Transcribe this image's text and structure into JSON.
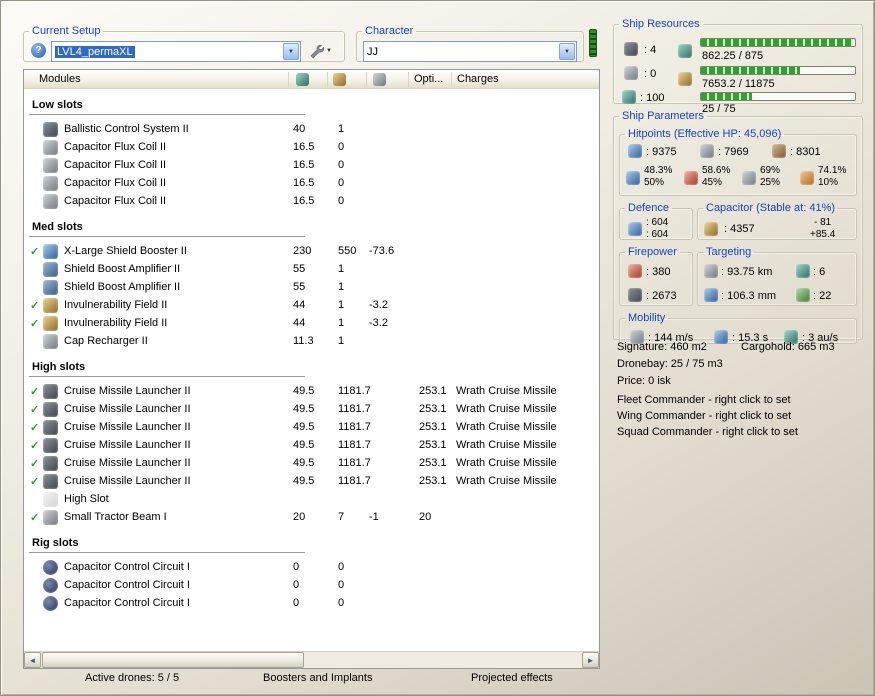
{
  "toolbar": {
    "current_setup_label": "Current Setup",
    "setup_value": "LVL4_permaXL",
    "character_label": "Character",
    "character_value": "JJ"
  },
  "modules_panel": {
    "title": "Modules",
    "col_opti": "Opti...",
    "col_charges": "Charges",
    "sections": [
      {
        "title": "Low slots",
        "rows": [
          {
            "active": false,
            "icon": "ballistic-control-icon",
            "name": "Ballistic Control System II",
            "cpu": "40",
            "pg": "1",
            "cap": "",
            "opti": "",
            "charge": ""
          },
          {
            "active": false,
            "icon": "capacitor-flux-coil-icon",
            "name": "Capacitor Flux Coil II",
            "cpu": "16.5",
            "pg": "0",
            "cap": "",
            "opti": "",
            "charge": ""
          },
          {
            "active": false,
            "icon": "capacitor-flux-coil-icon",
            "name": "Capacitor Flux Coil II",
            "cpu": "16.5",
            "pg": "0",
            "cap": "",
            "opti": "",
            "charge": ""
          },
          {
            "active": false,
            "icon": "capacitor-flux-coil-icon",
            "name": "Capacitor Flux Coil II",
            "cpu": "16.5",
            "pg": "0",
            "cap": "",
            "opti": "",
            "charge": ""
          },
          {
            "active": false,
            "icon": "capacitor-flux-coil-icon",
            "name": "Capacitor Flux Coil II",
            "cpu": "16.5",
            "pg": "0",
            "cap": "",
            "opti": "",
            "charge": ""
          }
        ]
      },
      {
        "title": "Med slots",
        "rows": [
          {
            "active": true,
            "icon": "shield-booster-icon",
            "name": "X-Large Shield Booster II",
            "cpu": "230",
            "pg": "550",
            "cap": "-73.6",
            "opti": "",
            "charge": ""
          },
          {
            "active": false,
            "icon": "shield-boost-amplifier-icon",
            "name": "Shield Boost Amplifier II",
            "cpu": "55",
            "pg": "1",
            "cap": "",
            "opti": "",
            "charge": ""
          },
          {
            "active": false,
            "icon": "shield-boost-amplifier-icon",
            "name": "Shield Boost Amplifier II",
            "cpu": "55",
            "pg": "1",
            "cap": "",
            "opti": "",
            "charge": ""
          },
          {
            "active": true,
            "icon": "invulnerability-field-icon",
            "name": "Invulnerability Field II",
            "cpu": "44",
            "pg": "1",
            "cap": "-3.2",
            "opti": "",
            "charge": ""
          },
          {
            "active": true,
            "icon": "invulnerability-field-icon",
            "name": "Invulnerability Field II",
            "cpu": "44",
            "pg": "1",
            "cap": "-3.2",
            "opti": "",
            "charge": ""
          },
          {
            "active": false,
            "icon": "cap-recharger-icon",
            "name": "Cap Recharger II",
            "cpu": "11.3",
            "pg": "1",
            "cap": "",
            "opti": "",
            "charge": ""
          }
        ]
      },
      {
        "title": "High slots",
        "rows": [
          {
            "active": true,
            "icon": "cruise-launcher-icon",
            "name": "Cruise Missile Launcher II",
            "cpu": "49.5",
            "pg": "1181.7",
            "cap": "",
            "opti": "253.1",
            "charge": "Wrath Cruise Missile"
          },
          {
            "active": true,
            "icon": "cruise-launcher-icon",
            "name": "Cruise Missile Launcher II",
            "cpu": "49.5",
            "pg": "1181.7",
            "cap": "",
            "opti": "253.1",
            "charge": "Wrath Cruise Missile"
          },
          {
            "active": true,
            "icon": "cruise-launcher-icon",
            "name": "Cruise Missile Launcher II",
            "cpu": "49.5",
            "pg": "1181.7",
            "cap": "",
            "opti": "253.1",
            "charge": "Wrath Cruise Missile"
          },
          {
            "active": true,
            "icon": "cruise-launcher-icon",
            "name": "Cruise Missile Launcher II",
            "cpu": "49.5",
            "pg": "1181.7",
            "cap": "",
            "opti": "253.1",
            "charge": "Wrath Cruise Missile"
          },
          {
            "active": true,
            "icon": "cruise-launcher-icon",
            "name": "Cruise Missile Launcher II",
            "cpu": "49.5",
            "pg": "1181.7",
            "cap": "",
            "opti": "253.1",
            "charge": "Wrath Cruise Missile"
          },
          {
            "active": true,
            "icon": "cruise-launcher-icon",
            "name": "Cruise Missile Launcher II",
            "cpu": "49.5",
            "pg": "1181.7",
            "cap": "",
            "opti": "253.1",
            "charge": "Wrath Cruise Missile"
          },
          {
            "active": false,
            "icon": "empty-high-slot-icon",
            "name": "High Slot",
            "cpu": "",
            "pg": "",
            "cap": "",
            "opti": "",
            "charge": ""
          },
          {
            "active": true,
            "icon": "tractor-beam-icon",
            "name": "Small Tractor Beam I",
            "cpu": "20",
            "pg": "7",
            "cap": "-1",
            "opti": "20",
            "charge": ""
          }
        ]
      },
      {
        "title": "Rig slots",
        "rows": [
          {
            "active": false,
            "icon": "rig-slot-icon",
            "name": "Capacitor Control Circuit I",
            "cpu": "0",
            "pg": "0",
            "cap": "",
            "opti": "",
            "charge": ""
          },
          {
            "active": false,
            "icon": "rig-slot-icon",
            "name": "Capacitor Control Circuit I",
            "cpu": "0",
            "pg": "0",
            "cap": "",
            "opti": "",
            "charge": ""
          },
          {
            "active": false,
            "icon": "rig-slot-icon",
            "name": "Capacitor Control Circuit I",
            "cpu": "0",
            "pg": "0",
            "cap": "",
            "opti": "",
            "charge": ""
          }
        ]
      }
    ]
  },
  "bottom_tabs": [
    {
      "label": "Active drones: 5 / 5"
    },
    {
      "label": "Boosters and Implants"
    },
    {
      "label": "Projected effects"
    }
  ],
  "ship_resources": {
    "title": "Ship Resources",
    "turrets": ": 4",
    "launchers": ": 0",
    "calibration": ": 100",
    "cpu_text": "862.25 / 875",
    "cpu_pct": 98.6,
    "powergrid_text": "7653.2 / 11875",
    "powergrid_pct": 64.4,
    "calibration_text": "25 / 75",
    "calibration_pct": 33.3
  },
  "ship_parameters": {
    "title": "Ship Parameters",
    "hitpoints": {
      "title": "Hitpoints (Effective HP: 45,096)",
      "shield": ": 9375",
      "armor": ": 7969",
      "structure": ": 8301",
      "resists": [
        {
          "name": "em",
          "top": "48.3%",
          "bottom": "50%"
        },
        {
          "name": "thermal",
          "top": "58.6%",
          "bottom": "45%"
        },
        {
          "name": "kinetic",
          "top": "69%",
          "bottom": "25%"
        },
        {
          "name": "explosive",
          "top": "74.1%",
          "bottom": "10%"
        }
      ]
    },
    "defence": {
      "title": "Defence",
      "value1": ": 604",
      "value2": ": 604"
    },
    "capacitor": {
      "title": "Capacitor (Stable at: 41%)",
      "amount": ": 4357",
      "delta_out": "- 81",
      "delta_in": "+85.4"
    },
    "firepower": {
      "title": "Firepower",
      "value1": ": 380",
      "value2": ": 2673"
    },
    "targeting": {
      "title": "Targeting",
      "range": ": 93.75 km",
      "max_targets": ": 6",
      "scan_res": ": 106.3 mm",
      "sensor_strength": ": 22"
    },
    "mobility": {
      "title": "Mobility",
      "speed": ": 144 m/s",
      "align_time": ": 15.3 s",
      "warp_speed": ": 3 au/s"
    },
    "info": {
      "signature": "Signature: 460 m2",
      "cargohold": "Cargohold: 665 m3",
      "dronebay": "Dronebay: 25 / 75 m3",
      "price": "Price: 0 isk",
      "fleet": "Fleet Commander - right click to set",
      "wing": "Wing Commander - right click to set",
      "squad": "Squad Commander - right click to set"
    }
  }
}
